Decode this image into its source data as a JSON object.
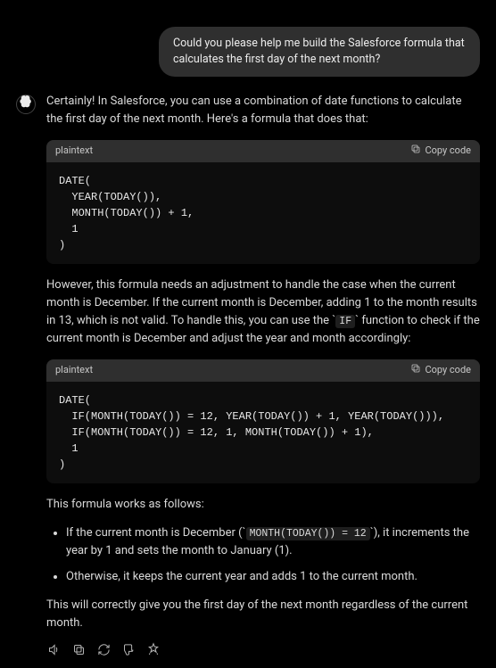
{
  "user": {
    "message": "Could you please help me build the Salesforce formula that calculates the first day of the next month?"
  },
  "assistant": {
    "intro": "Certainly! In Salesforce, you can use a combination of date functions to calculate the first day of the next month. Here's a formula that does that:",
    "code1": {
      "lang": "plaintext",
      "copy_label": "Copy code",
      "content": "DATE(\n  YEAR(TODAY()),\n  MONTH(TODAY()) + 1,\n  1\n)"
    },
    "middle_a": "However, this formula needs an adjustment to handle the case when the current month is December. If the current month is December, adding 1 to the month results in 13, which is not valid. To handle this, you can use the ",
    "middle_code": "IF",
    "middle_b": " function to check if the current month is December and adjust the year and month accordingly:",
    "code2": {
      "lang": "plaintext",
      "copy_label": "Copy code",
      "content": "DATE(\n  IF(MONTH(TODAY()) = 12, YEAR(TODAY()) + 1, YEAR(TODAY())),\n  IF(MONTH(TODAY()) = 12, 1, MONTH(TODAY()) + 1),\n  1\n)"
    },
    "works_as": "This formula works as follows:",
    "bullet1_a": "If the current month is December (",
    "bullet1_code": "MONTH(TODAY()) = 12",
    "bullet1_b": "), it increments the year by 1 and sets the month to January (1).",
    "bullet2": "Otherwise, it keeps the current year and adds 1 to the current month.",
    "outro": "This will correctly give you the first day of the next month regardless of the current month."
  }
}
